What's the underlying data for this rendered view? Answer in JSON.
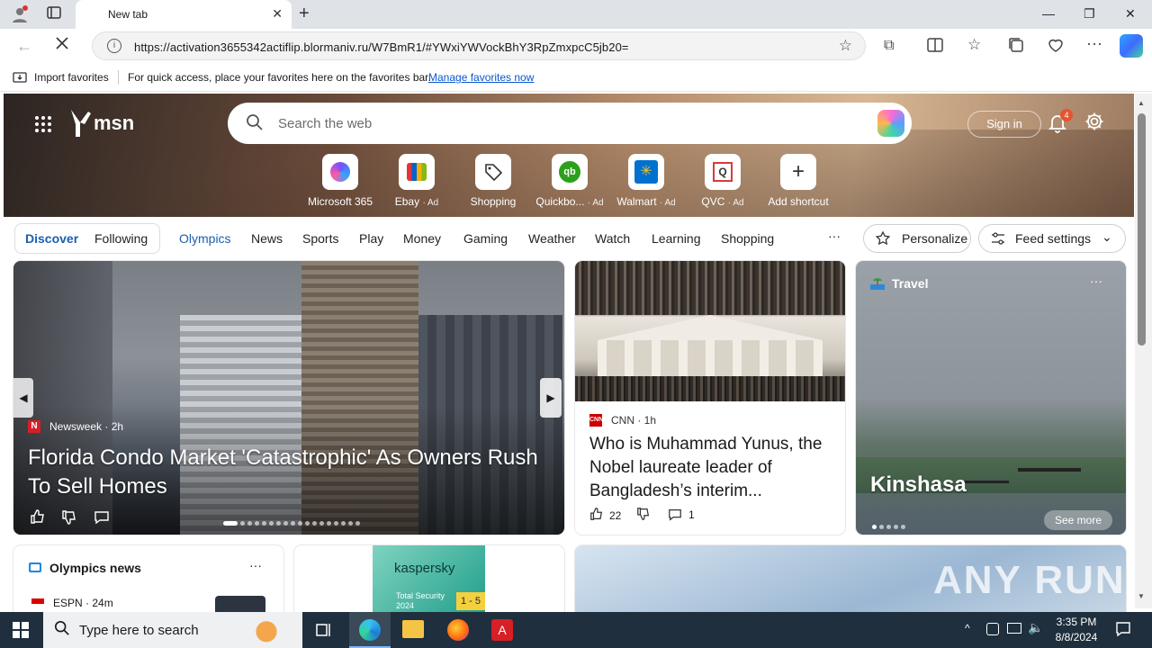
{
  "browser": {
    "tab_title": "New tab",
    "url": "https://activation3655342actiflip.blormaniv.ru/W7BmR1/#YWxiYWVockBhY3RpZmxpcC5jb20=",
    "favorites_bar": {
      "import_label": "Import favorites",
      "message": "For quick access, place your favorites here on the favorites bar.",
      "manage_link": "Manage favorites now"
    }
  },
  "msn": {
    "logo_text": "msn",
    "search_placeholder": "Search the web",
    "sign_in": "Sign in",
    "notification_count": "4",
    "shortcuts": [
      {
        "label": "Microsoft 365",
        "ad": "",
        "icon": "microsoft-365-icon"
      },
      {
        "label": "Ebay",
        "ad": "· Ad",
        "icon": "ebay-icon"
      },
      {
        "label": "Shopping",
        "ad": "",
        "icon": "shopping-tag-icon"
      },
      {
        "label": "Quickbo...",
        "ad": "· Ad",
        "icon": "quickbooks-icon"
      },
      {
        "label": "Walmart",
        "ad": "· Ad",
        "icon": "walmart-icon"
      },
      {
        "label": "QVC",
        "ad": "· Ad",
        "icon": "qvc-icon"
      },
      {
        "label": "Add shortcut",
        "ad": "",
        "icon": "plus-icon"
      }
    ]
  },
  "feed_nav": {
    "discover": "Discover",
    "following": "Following",
    "items": [
      "Olympics",
      "News",
      "Sports",
      "Play",
      "Money",
      "Gaming",
      "Weather",
      "Watch",
      "Learning",
      "Shopping"
    ],
    "more": "···",
    "personalize": "Personalize",
    "feed_settings": "Feed settings"
  },
  "cards": {
    "main": {
      "source": "Newsweek",
      "age": "· 2h",
      "title": "Florida Condo Market 'Catastrophic' As Owners Rush To Sell Homes"
    },
    "cnn": {
      "source": "CNN",
      "age": "· 1h",
      "title": "Who is Muhammad Yunus, the Nobel laureate leader of Bangladesh’s interim...",
      "likes": "22",
      "comments": "1"
    },
    "travel": {
      "category": "Travel",
      "title": "Kinshasa",
      "see_more": "See more",
      "menu": "···"
    },
    "olympics": {
      "title": "Olympics news",
      "source": "ESPN",
      "age": "· 24m",
      "menu": "···"
    },
    "kaspersky": {
      "brand": "kaspersky",
      "product": "Total Security",
      "year": "2024",
      "devices": "1 - 5"
    },
    "watermark": "ANY RUN"
  },
  "taskbar": {
    "search_placeholder": "Type here to search",
    "time": "3:35 PM",
    "date": "8/8/2024"
  }
}
